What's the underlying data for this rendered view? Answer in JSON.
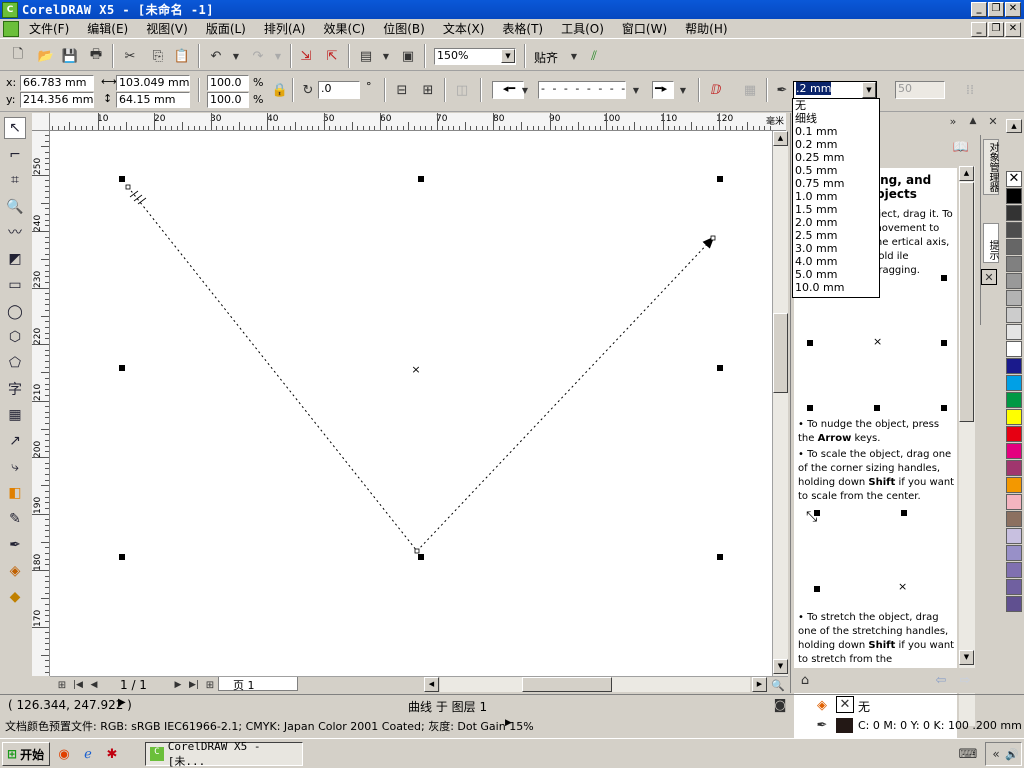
{
  "window": {
    "title": "CorelDRAW X5 - [未命名 -1]",
    "app_icon": "coreldraw-icon"
  },
  "menu": [
    "文件(F)",
    "编辑(E)",
    "视图(V)",
    "版面(L)",
    "排列(A)",
    "效果(C)",
    "位图(B)",
    "文本(X)",
    "表格(T)",
    "工具(O)",
    "窗口(W)",
    "帮助(H)"
  ],
  "standard_toolbar": {
    "zoom": "150%",
    "snap_label": "贴齐"
  },
  "property_bar": {
    "x": "66.783 mm",
    "y": "214.356 mm",
    "width": "103.049 mm",
    "height": "64.15 mm",
    "scale_x": "100.0",
    "scale_y": "100.0",
    "percent": "%",
    "angle": ".0",
    "degree": "°",
    "outline_width": ".2 mm",
    "miter": "50"
  },
  "outline_width_dropdown": [
    "无",
    "细线",
    "0.1 mm",
    "0.2 mm",
    "0.25 mm",
    "0.5 mm",
    "0.75 mm",
    "1.0 mm",
    "1.5 mm",
    "2.0 mm",
    "2.5 mm",
    "3.0 mm",
    "4.0 mm",
    "5.0 mm",
    "10.0 mm"
  ],
  "ruler": {
    "h_labels": [
      "10",
      "20",
      "30",
      "40",
      "50",
      "60",
      "70",
      "80",
      "90",
      "100",
      "110",
      "120",
      "毫米"
    ],
    "v_labels": [
      "250",
      "240",
      "230",
      "220",
      "210",
      "200",
      "190",
      "180",
      "170"
    ]
  },
  "page_nav": {
    "page_count": "1 / 1",
    "page_tab": "页 1"
  },
  "docker": {
    "heading": "ing, and bjects",
    "intro": "bject, drag it. To movement to the ertical axis, hold ile dragging.",
    "bullet1_a": "To nudge the object, press the",
    "bullet1_b": "Arrow",
    "bullet1_c": "keys.",
    "bullet2_a": "To scale the object, drag one of the corner sizing handles, holding down",
    "bullet2_b": "Shift",
    "bullet2_c": "if you want to scale from the center.",
    "bullet3_a": "To stretch the object, drag one of the stretching handles, holding down",
    "bullet3_b": "Shift",
    "bullet3_c": "if you want to stretch from the",
    "side_tab1": "对象管理器",
    "side_tab2": "提示"
  },
  "status": {
    "coords": "( 126.344, 247.922 )",
    "object": "曲线 于 图层 1",
    "fill_none": "无",
    "profile": "文档颜色预置文件: RGB: sRGB IEC61966-2.1; CMYK: Japan Color 2001 Coated; 灰度: Dot Gain 15%",
    "outline": "C: 0 M: 0 Y: 0 K: 100  .200 mm"
  },
  "taskbar": {
    "start": "开始",
    "task": "CorelDRAW X5 - [未..."
  },
  "palette_colors": [
    "#000000",
    "#333333",
    "#4d4d4d",
    "#666666",
    "#808080",
    "#999999",
    "#b3b3b3",
    "#cccccc",
    "#e5e5e5",
    "#ffffff",
    "#1a1a8c",
    "#00a0e6",
    "#009944",
    "#ffff00",
    "#e60012",
    "#e4007f",
    "#a0366e",
    "#f39800",
    "#f4b4c0",
    "#8c7060",
    "#c8c0e0",
    "#9890c8",
    "#8070b0",
    "#7060a0",
    "#605090"
  ]
}
